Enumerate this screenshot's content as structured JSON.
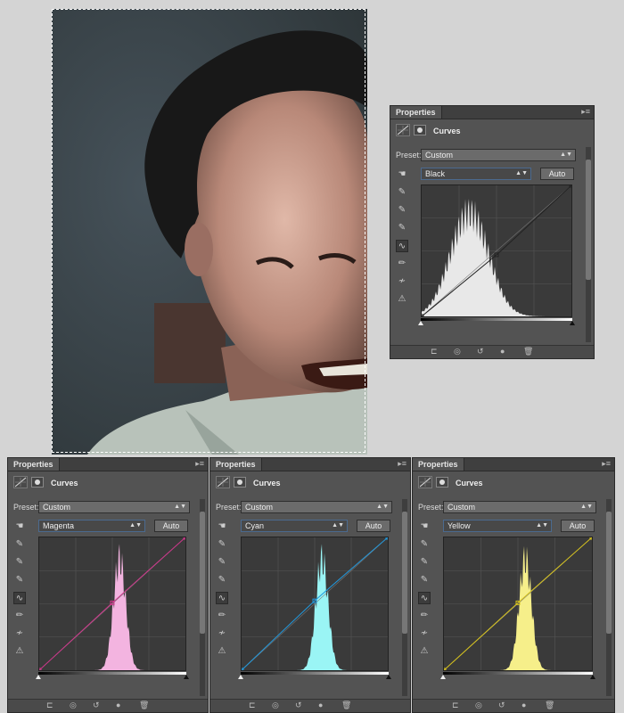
{
  "photo": {
    "colors": {
      "background": "#3a4447",
      "skin": "#c49a86",
      "hair": "#1a1a1a",
      "shirt": "#b8c2ba"
    }
  },
  "panels": [
    {
      "id": "black",
      "tab": "Properties",
      "title": "Curves",
      "preset_label": "Preset:",
      "preset": "Custom",
      "channel": "Black",
      "auto": "Auto",
      "curve_color": "#222222",
      "hist_color": "#e8e8e8",
      "hist_peak": 0.3
    },
    {
      "id": "magenta",
      "tab": "Properties",
      "title": "Curves",
      "preset_label": "Preset:",
      "preset": "Custom",
      "channel": "Magenta",
      "auto": "Auto",
      "curve_color": "#d0368c",
      "hist_color": "#f3b4e0",
      "hist_peak": 0.55
    },
    {
      "id": "cyan",
      "tab": "Properties",
      "title": "Curves",
      "preset_label": "Preset:",
      "preset": "Custom",
      "channel": "Cyan",
      "auto": "Auto",
      "curve_color": "#2299dd",
      "hist_color": "#9af5f5",
      "hist_peak": 0.65
    },
    {
      "id": "yellow",
      "tab": "Properties",
      "title": "Curves",
      "preset_label": "Preset:",
      "preset": "Custom",
      "channel": "Yellow",
      "auto": "Auto",
      "curve_color": "#d8c41c",
      "hist_color": "#f6ef8a",
      "hist_peak": 0.55
    }
  ],
  "tools": [
    "hand-adjust-icon",
    "eyedropper-black-icon",
    "eyedropper-gray-icon",
    "eyedropper-white-icon",
    "curve-points-icon",
    "pencil-icon",
    "smooth-icon",
    "clipping-warning-icon"
  ],
  "footer_icons": [
    "clip-to-layer-icon",
    "view-previous-icon",
    "reset-icon",
    "visibility-icon",
    "delete-icon"
  ]
}
